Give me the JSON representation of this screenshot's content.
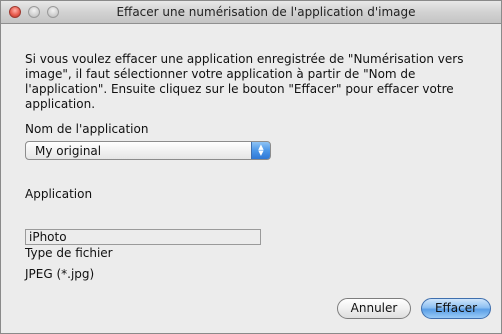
{
  "window": {
    "title": "Effacer une numérisation de l'application d'image"
  },
  "dialog": {
    "description": "Si vous voulez effacer une application enregistrée de \"Numérisation vers image\", il faut sélectionner votre application à partir de \"Nom de l'application\". Ensuite cliquez sur le bouton \"Effacer\" pour effacer votre application.",
    "app_name_label": "Nom de l'application",
    "app_name_selected": "My original",
    "application_label": "Application",
    "application_value": "iPhoto",
    "file_type_label": "Type de fichier",
    "file_type_value": "JPEG (*.jpg)"
  },
  "buttons": {
    "cancel_label": "Annuler",
    "delete_label": "Effacer"
  },
  "colors": {
    "accent": "#4c97e8",
    "close_button": "#e85d4f"
  }
}
